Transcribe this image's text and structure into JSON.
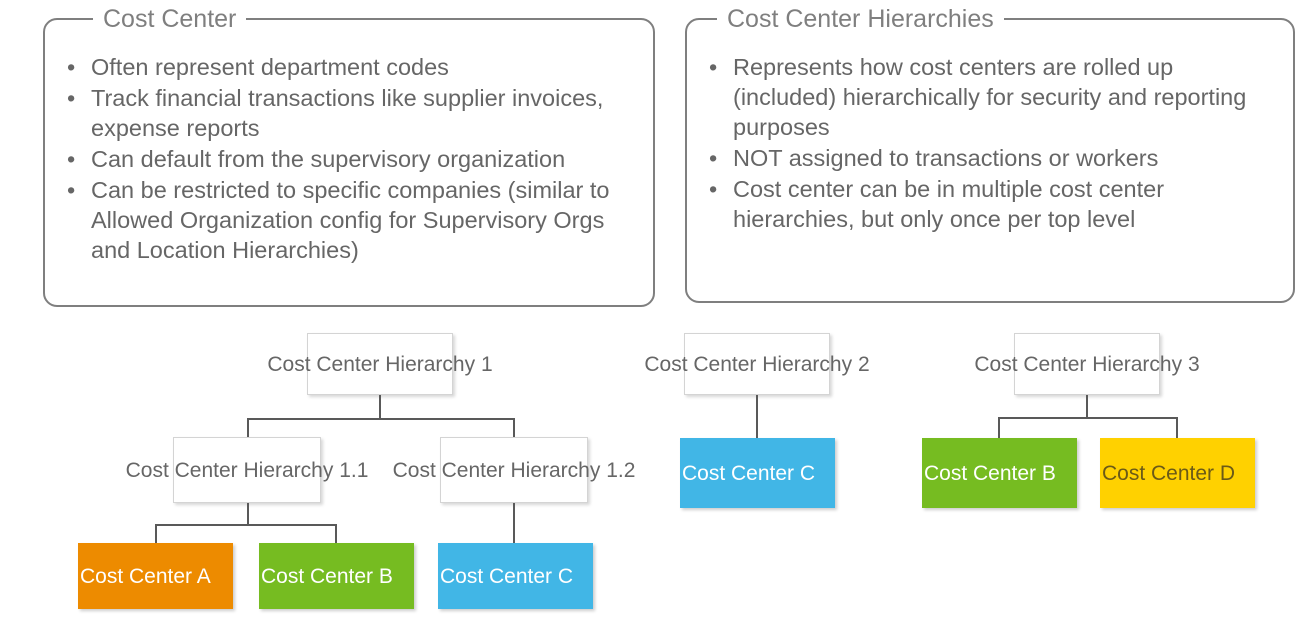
{
  "panels": [
    {
      "title": "Cost Center",
      "bullets": [
        "Often represent department codes",
        "Track financial transactions like supplier invoices, expense reports",
        "Can default from the supervisory organization",
        "Can be restricted to specific companies (similar to Allowed Organization config for Supervisory Orgs and Location Hierarchies)"
      ]
    },
    {
      "title": "Cost Center Hierarchies",
      "bullets": [
        "Represents how cost centers are rolled up (included) hierarchically for security and reporting purposes",
        "NOT assigned to transactions or workers",
        "Cost center can be in multiple cost center hierarchies, but only once per top level"
      ]
    }
  ],
  "bullet_glyph": "•",
  "diagram": {
    "hierarchy1": {
      "root": "Cost Center Hierarchy 1",
      "branch_a": "Cost Center Hierarchy 1.1",
      "branch_b": "Cost Center Hierarchy 1.2",
      "leaf_a": "Cost Center A",
      "leaf_b": "Cost Center B",
      "leaf_c": "Cost Center C"
    },
    "hierarchy2": {
      "root": "Cost Center Hierarchy 2",
      "leaf_c": "Cost Center C"
    },
    "hierarchy3": {
      "root": "Cost Center Hierarchy 3",
      "leaf_b": "Cost Center B",
      "leaf_d": "Cost Center D"
    }
  },
  "colors": {
    "orange": "#ED8B00",
    "green": "#76BC21",
    "blue": "#41B6E6",
    "yellow": "#FFD100",
    "yellow_text": "#6B5A17",
    "panel_border": "#7f7f7f",
    "text": "#666666",
    "connector": "#595959"
  }
}
